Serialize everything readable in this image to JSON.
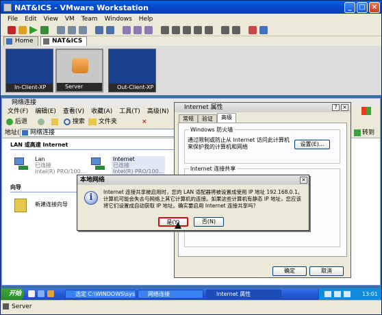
{
  "vmware": {
    "title": "NAT&ICS - VMware Workstation",
    "menu": [
      "File",
      "Edit",
      "View",
      "VM",
      "Team",
      "Windows",
      "Help"
    ],
    "tabs": [
      {
        "label": "Home"
      },
      {
        "label": "NAT&ICS"
      }
    ],
    "thumbnails": [
      {
        "label": "In-Client-XP"
      },
      {
        "label": "Server"
      },
      {
        "label": "Out-Client-XP"
      }
    ],
    "status": "Server"
  },
  "netwin": {
    "title": "网络连接",
    "menu": [
      "文件(F)",
      "编辑(E)",
      "查看(V)",
      "收藏(A)",
      "工具(T)",
      "高级(N)",
      "帮助"
    ],
    "toolbar": {
      "back": "后退",
      "search": "搜索",
      "folders": "文件夹"
    },
    "address": {
      "label": "地址(D)",
      "value": "网络连接",
      "go": "转到"
    },
    "group_lan": "LAN 或高速 Internet",
    "connections": [
      {
        "name": "Lan",
        "status": "已连接",
        "device": "Intel(R) PRO/100..."
      },
      {
        "name": "Internet",
        "status": "已连接",
        "device": "Intel(R) PRO/100..."
      }
    ],
    "group_wizard": "向导",
    "wizard_item": "新建连接向导"
  },
  "props": {
    "title": "Internet 属性",
    "tabs": [
      "常规",
      "验证",
      "高级"
    ],
    "firewall_legend": "Windows 防火墙",
    "firewall_text": "通过限制或防止从 Internet 访问此计算机来保护我的计算机和网络",
    "settings_btn": "设置(E)...",
    "ics_legend": "Internet 连接共享",
    "ok": "确定",
    "cancel": "取消"
  },
  "msgbox": {
    "title": "本地网络",
    "text": "Internet 连接共享被启用时，您的 LAN 适配器将被设置成使用 IP 地址 192.168.0.1。计算机可能会失去与网络上其它计算机的连接。如果这些计算机有静态 IP 地址，您应该将它们设置成自动获取 IP 地址。确实要启用 Internet 连接共享吗？",
    "yes": "是(Y)",
    "no": "否(N)"
  },
  "taskbar": {
    "start": "开始",
    "items": [
      "选定 C:\\WINDOWS\\sys...",
      "网络连接",
      "Internet 属性"
    ],
    "clock": "13:01"
  },
  "colors": {
    "xp_blue": "#0548c8",
    "desktop": "#3a6ea5",
    "default_button_border": "#d01010"
  }
}
